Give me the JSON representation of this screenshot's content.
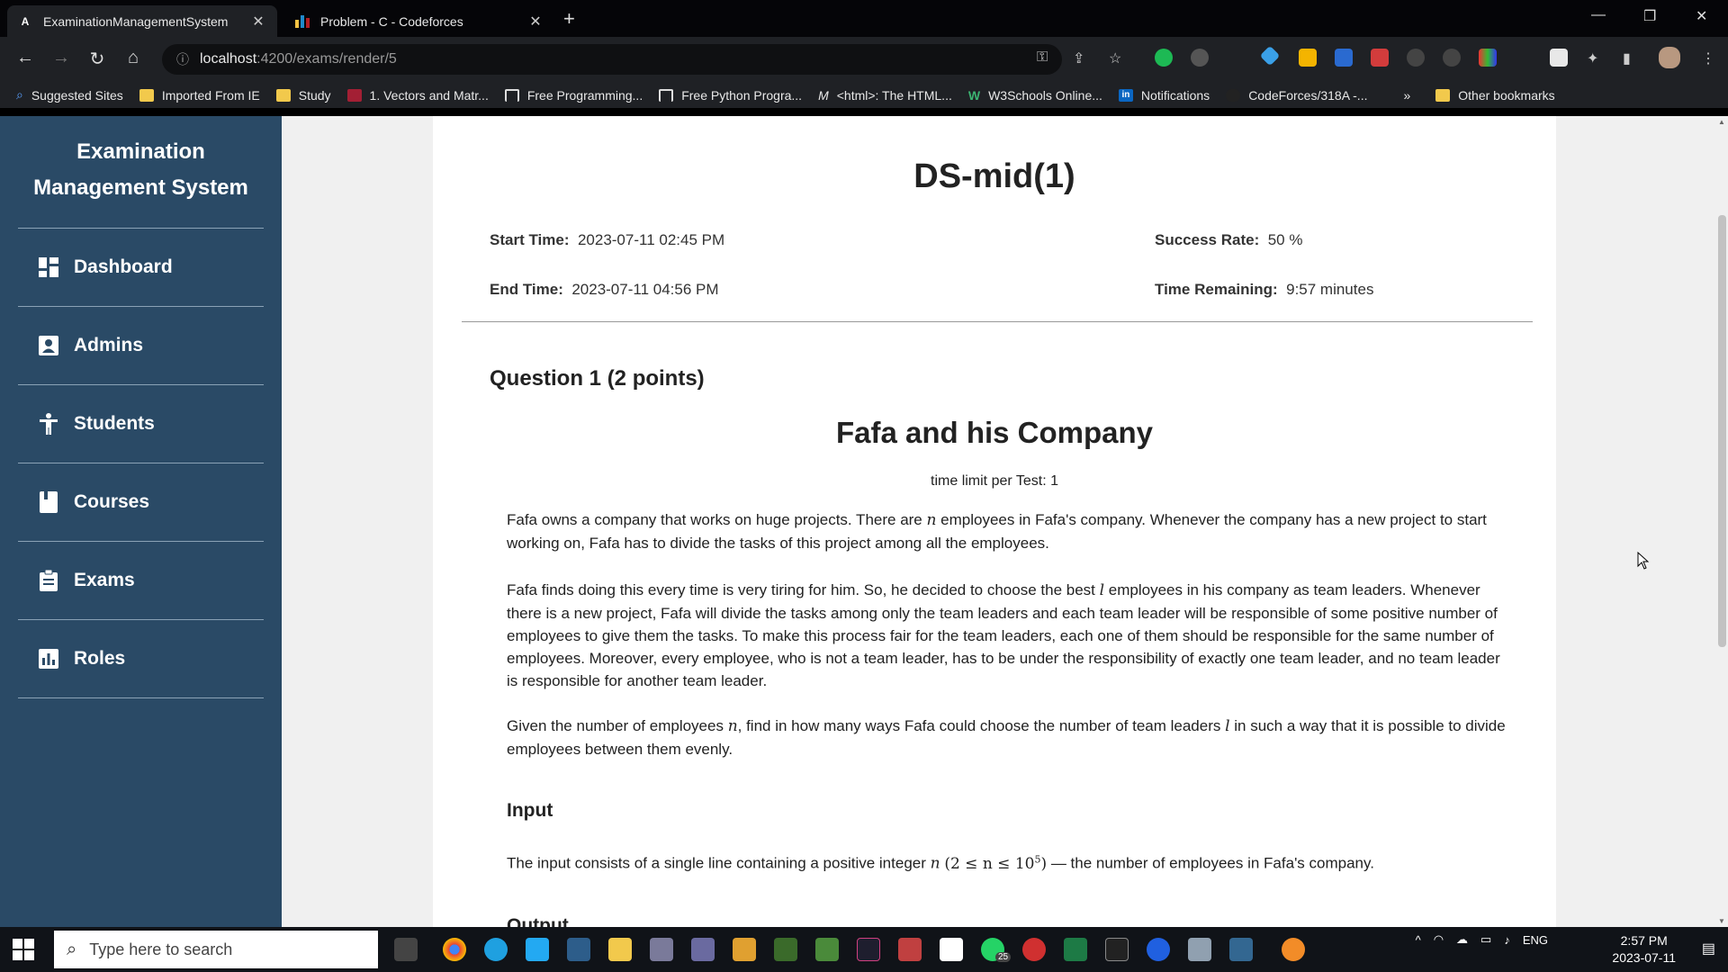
{
  "browser": {
    "tabs": [
      {
        "title": "ExaminationManagementSystem",
        "active": true
      },
      {
        "title": "Problem - C - Codeforces",
        "active": false
      }
    ],
    "url_host": "localhost",
    "url_path": ":4200/exams/render/5",
    "bookmarks": [
      {
        "label": "Suggested Sites",
        "icon": "search-icon"
      },
      {
        "label": "Imported From IE",
        "icon": "folder-icon"
      },
      {
        "label": "Study",
        "icon": "folder-icon"
      },
      {
        "label": "1. Vectors and Matr...",
        "icon": "mit-icon"
      },
      {
        "label": "Free Programming...",
        "icon": "fcc-icon"
      },
      {
        "label": "Free Python Progra...",
        "icon": "fcc-icon"
      },
      {
        "label": "<html>: The HTML...",
        "icon": "mdn-icon"
      },
      {
        "label": "W3Schools Online...",
        "icon": "w3-icon"
      },
      {
        "label": "Notifications",
        "icon": "linkedin-icon"
      },
      {
        "label": "CodeForces/318A -...",
        "icon": "github-icon"
      }
    ],
    "other_bookmarks": "Other bookmarks",
    "overflow": "»"
  },
  "sidebar": {
    "brand_line1": "Examination",
    "brand_line2": "Management System",
    "items": [
      {
        "label": "Dashboard",
        "icon": "dashboard-icon"
      },
      {
        "label": "Admins",
        "icon": "admin-icon"
      },
      {
        "label": "Students",
        "icon": "student-icon"
      },
      {
        "label": "Courses",
        "icon": "book-icon"
      },
      {
        "label": "Exams",
        "icon": "clipboard-icon"
      },
      {
        "label": "Roles",
        "icon": "chart-icon"
      }
    ]
  },
  "exam": {
    "title": "DS-mid(1)",
    "start_label": "Start Time:",
    "start_value": "2023-07-11 02:45 PM",
    "end_label": "End Time:",
    "end_value": "2023-07-11 04:56 PM",
    "success_label": "Success Rate:",
    "success_value": "50 %",
    "remaining_label": "Time Remaining:",
    "remaining_value": "9:57 minutes"
  },
  "question": {
    "heading": "Question 1 (2 points)",
    "problem_title": "Fafa and his Company",
    "time_limit": "time limit per Test: 1",
    "p1a": "Fafa owns a company that works on huge projects. There are ",
    "var_n": "n",
    "p1b": " employees in Fafa's company. Whenever the company has a new project to start working on, Fafa has to divide the tasks of this project among all the employees.",
    "p2a": "Fafa finds doing this every time is very tiring for him. So, he decided to choose the best ",
    "var_l": "l",
    "p2b": " employees in his company as team leaders. Whenever there is a new project, Fafa will divide the tasks among only the team leaders and each team leader will be responsible of some positive number of employees to give them the tasks. To make this process fair for the team leaders, each one of them should be responsible for the same number of employees. Moreover, every employee, who is not a team leader, has to be under the responsibility of exactly one team leader, and no team leader is responsible for another team leader.",
    "p3a": "Given the number of employees ",
    "p3b": ", find in how many ways Fafa could choose the number of team leaders ",
    "p3c": " in such a way that it is possible to divide employees between them evenly.",
    "input_heading": "Input",
    "input_a": "The input consists of a single line containing a positive integer ",
    "input_math": "(2 ≤ n ≤ 10",
    "input_exp": "5",
    "input_close": ")",
    "input_b": " — the number of employees in Fafa's company.",
    "output_heading": "Output"
  },
  "taskbar": {
    "search_placeholder": "Type here to search",
    "time": "2:57 PM",
    "date": "2023-07-11",
    "lang": "ENG",
    "badge": "25"
  },
  "colors": {
    "sidebar": "#2a4a66",
    "page_bg": "#f0f0f0",
    "card": "#ffffff"
  }
}
